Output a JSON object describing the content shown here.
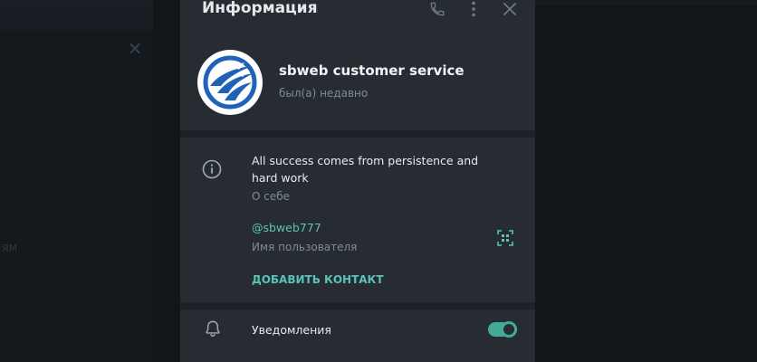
{
  "background": {
    "fragment_text": "ЯМ"
  },
  "modal": {
    "title": "Информация",
    "header_icons": [
      "phone-icon",
      "more-vertical-icon",
      "close-icon"
    ]
  },
  "profile": {
    "name": "sbweb customer service",
    "status": "был(а) недавно"
  },
  "info": {
    "bio": "All success comes from persistence and hard work",
    "bio_label": "О себе",
    "username": "@sbweb777",
    "username_label": "Имя пользователя",
    "add_contact_label": "ДОБАВИТЬ КОНТАКТ"
  },
  "notifications": {
    "label": "Уведомления",
    "enabled": true
  },
  "colors": {
    "accent": "#5ac4b4",
    "toggle": "#43a999",
    "modal_bg": "#272c33",
    "logo_blue": "#1f62b7"
  }
}
